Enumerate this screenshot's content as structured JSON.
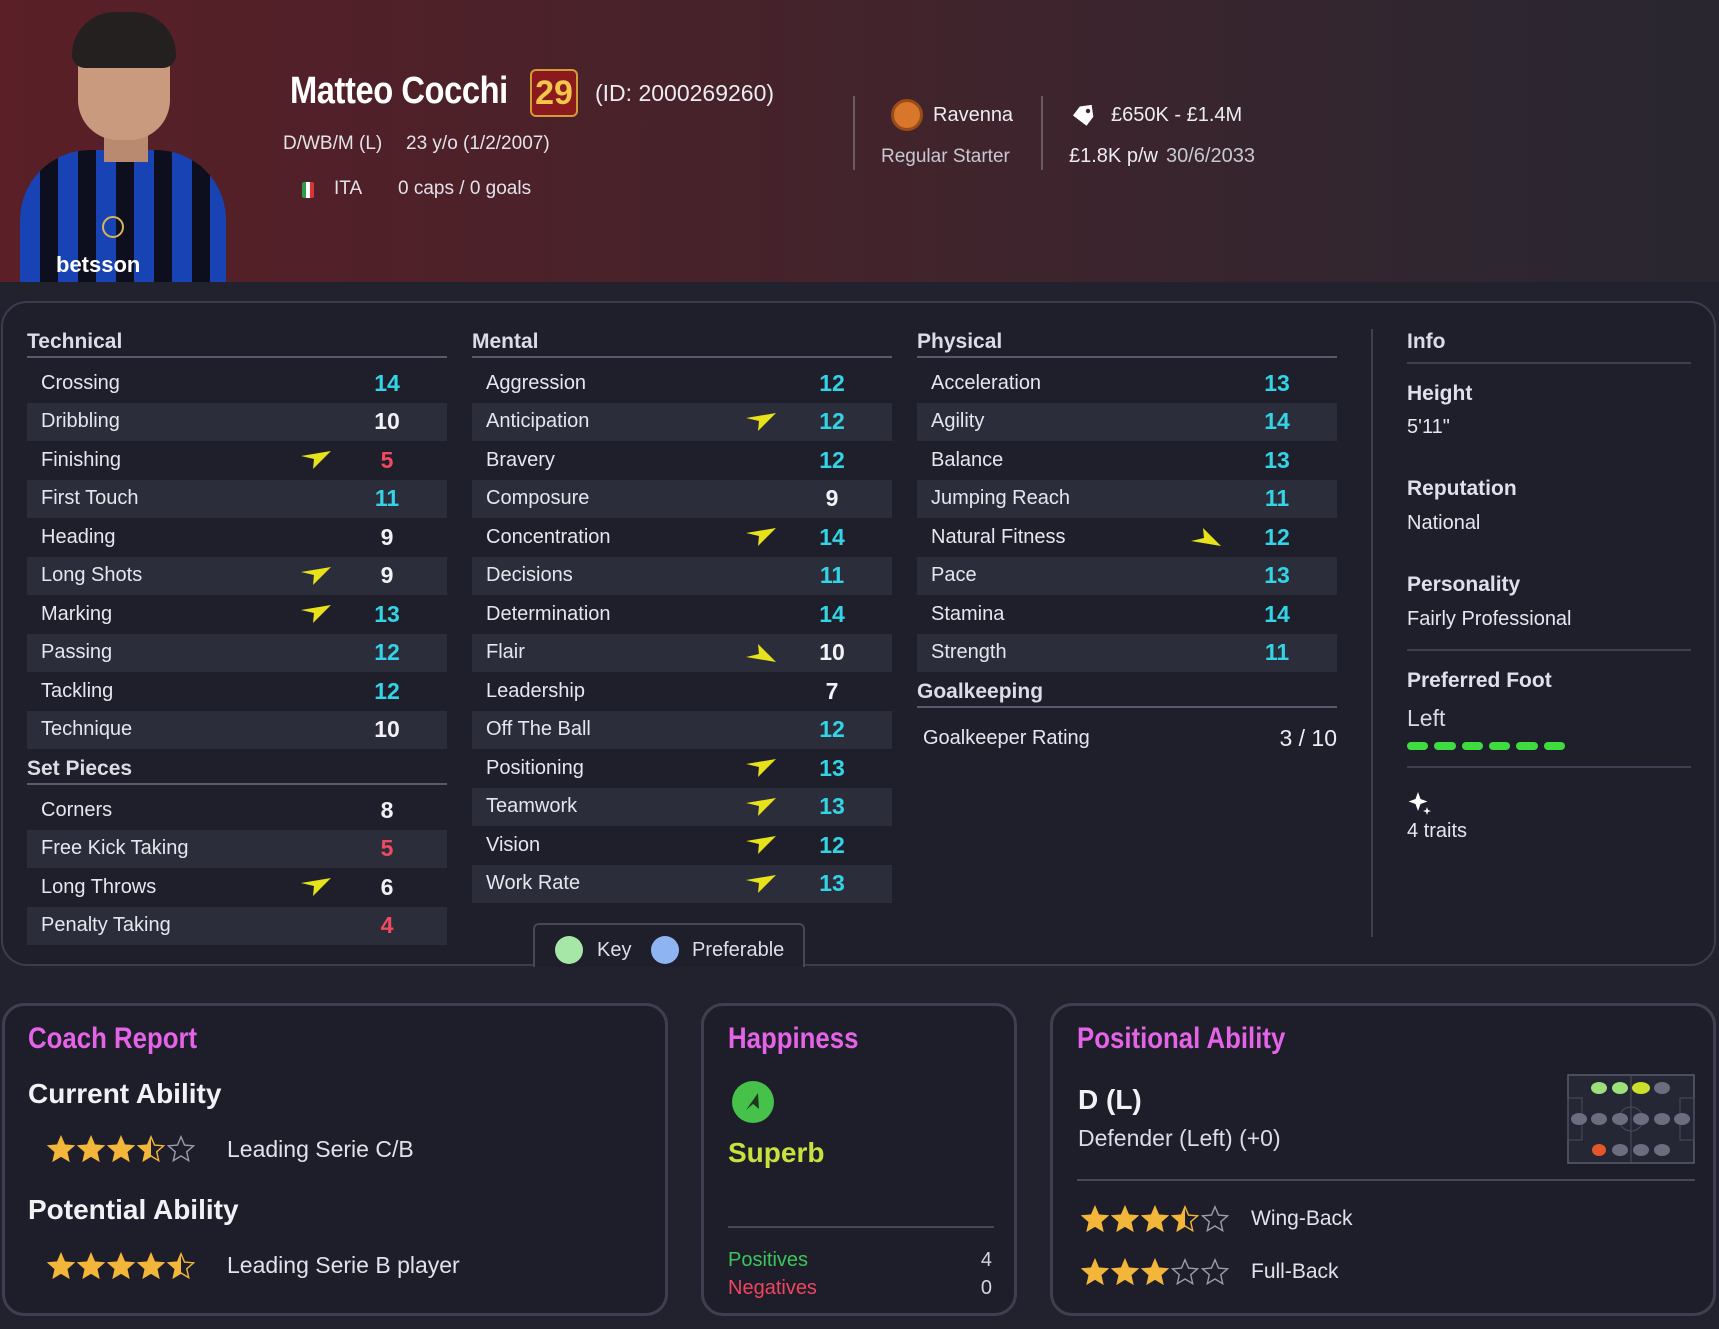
{
  "player": {
    "name": "Matteo Cocchi",
    "current_ability_badge": "29",
    "id_text": "(ID: 2000269260)",
    "positions": "D/WB/M (L)",
    "age": "23 y/o (1/2/2007)",
    "nation": "ITA",
    "caps": "0 caps / 0 goals",
    "photo_sponsor_text": "betsson"
  },
  "club": {
    "name": "Ravenna",
    "squad_status": "Regular Starter",
    "value": "£650K - £1.4M",
    "wage": "£1.8K p/w",
    "contract_end": "30/6/2033"
  },
  "colors": {
    "attr_high": "#33d4e6",
    "attr_low": "#f04a61",
    "arrow": "#e8e21a",
    "key_dot": "#a6e6a6",
    "preferable_dot": "#8fb4f2",
    "title_pink": "#e463e6",
    "happy_green": "#46c24b",
    "positives": "#3ac65a",
    "negatives": "#f0455d",
    "star": "#f3b63a"
  },
  "technical": {
    "title": "Technical",
    "attrs": [
      {
        "name": "Crossing",
        "value": "14",
        "tone": "hi",
        "arrow": "none"
      },
      {
        "name": "Dribbling",
        "value": "10",
        "tone": "",
        "arrow": "none"
      },
      {
        "name": "Finishing",
        "value": "5",
        "tone": "lo",
        "arrow": "up"
      },
      {
        "name": "First Touch",
        "value": "11",
        "tone": "hi",
        "arrow": "none"
      },
      {
        "name": "Heading",
        "value": "9",
        "tone": "",
        "arrow": "none"
      },
      {
        "name": "Long Shots",
        "value": "9",
        "tone": "",
        "arrow": "up"
      },
      {
        "name": "Marking",
        "value": "13",
        "tone": "hi",
        "arrow": "up"
      },
      {
        "name": "Passing",
        "value": "12",
        "tone": "hi",
        "arrow": "none"
      },
      {
        "name": "Tackling",
        "value": "12",
        "tone": "hi",
        "arrow": "none"
      },
      {
        "name": "Technique",
        "value": "10",
        "tone": "",
        "arrow": "none"
      }
    ]
  },
  "set_pieces": {
    "title": "Set Pieces",
    "attrs": [
      {
        "name": "Corners",
        "value": "8",
        "tone": "",
        "arrow": "none"
      },
      {
        "name": "Free Kick Taking",
        "value": "5",
        "tone": "lo",
        "arrow": "none"
      },
      {
        "name": "Long Throws",
        "value": "6",
        "tone": "",
        "arrow": "up"
      },
      {
        "name": "Penalty Taking",
        "value": "4",
        "tone": "lo",
        "arrow": "none"
      }
    ]
  },
  "mental": {
    "title": "Mental",
    "attrs": [
      {
        "name": "Aggression",
        "value": "12",
        "tone": "hi",
        "arrow": "none"
      },
      {
        "name": "Anticipation",
        "value": "12",
        "tone": "hi",
        "arrow": "up"
      },
      {
        "name": "Bravery",
        "value": "12",
        "tone": "hi",
        "arrow": "none"
      },
      {
        "name": "Composure",
        "value": "9",
        "tone": "",
        "arrow": "none"
      },
      {
        "name": "Concentration",
        "value": "14",
        "tone": "hi",
        "arrow": "up"
      },
      {
        "name": "Decisions",
        "value": "11",
        "tone": "hi",
        "arrow": "none"
      },
      {
        "name": "Determination",
        "value": "14",
        "tone": "hi",
        "arrow": "none"
      },
      {
        "name": "Flair",
        "value": "10",
        "tone": "",
        "arrow": "down"
      },
      {
        "name": "Leadership",
        "value": "7",
        "tone": "",
        "arrow": "none"
      },
      {
        "name": "Off The Ball",
        "value": "12",
        "tone": "hi",
        "arrow": "none"
      },
      {
        "name": "Positioning",
        "value": "13",
        "tone": "hi",
        "arrow": "up"
      },
      {
        "name": "Teamwork",
        "value": "13",
        "tone": "hi",
        "arrow": "up"
      },
      {
        "name": "Vision",
        "value": "12",
        "tone": "hi",
        "arrow": "up"
      },
      {
        "name": "Work Rate",
        "value": "13",
        "tone": "hi",
        "arrow": "up"
      }
    ]
  },
  "physical": {
    "title": "Physical",
    "attrs": [
      {
        "name": "Acceleration",
        "value": "13",
        "tone": "hi",
        "arrow": "none"
      },
      {
        "name": "Agility",
        "value": "14",
        "tone": "hi",
        "arrow": "none"
      },
      {
        "name": "Balance",
        "value": "13",
        "tone": "hi",
        "arrow": "none"
      },
      {
        "name": "Jumping Reach",
        "value": "11",
        "tone": "hi",
        "arrow": "none"
      },
      {
        "name": "Natural Fitness",
        "value": "12",
        "tone": "hi",
        "arrow": "down"
      },
      {
        "name": "Pace",
        "value": "13",
        "tone": "hi",
        "arrow": "none"
      },
      {
        "name": "Stamina",
        "value": "14",
        "tone": "hi",
        "arrow": "none"
      },
      {
        "name": "Strength",
        "value": "11",
        "tone": "hi",
        "arrow": "none"
      }
    ]
  },
  "goalkeeping": {
    "title": "Goalkeeping",
    "rating_label": "Goalkeeper Rating",
    "rating_value": "3 / 10"
  },
  "legend": {
    "key": "Key",
    "preferable": "Preferable"
  },
  "info": {
    "title": "Info",
    "height_label": "Height",
    "height": "5'11\"",
    "reputation_label": "Reputation",
    "reputation": "National",
    "personality_label": "Personality",
    "personality": "Fairly Professional",
    "foot_label": "Preferred Foot",
    "foot": "Left",
    "foot_level": 1.0,
    "traits": "4 traits"
  },
  "coach_report": {
    "title": "Coach Report",
    "current_label": "Current Ability",
    "current_stars": 3.5,
    "current_text": "Leading Serie C/B",
    "potential_label": "Potential Ability",
    "potential_stars": 4.5,
    "potential_text": "Leading Serie B player"
  },
  "happiness": {
    "title": "Happiness",
    "status": "Superb",
    "positives_label": "Positives",
    "positives": "4",
    "negatives_label": "Negatives",
    "negatives": "0"
  },
  "positional": {
    "title": "Positional Ability",
    "position": "D (L)",
    "position_full": "Defender (Left) (+0)",
    "roles": [
      {
        "name": "Wing-Back",
        "stars": 3.5
      },
      {
        "name": "Full-Back",
        "stars": 3
      }
    ]
  }
}
